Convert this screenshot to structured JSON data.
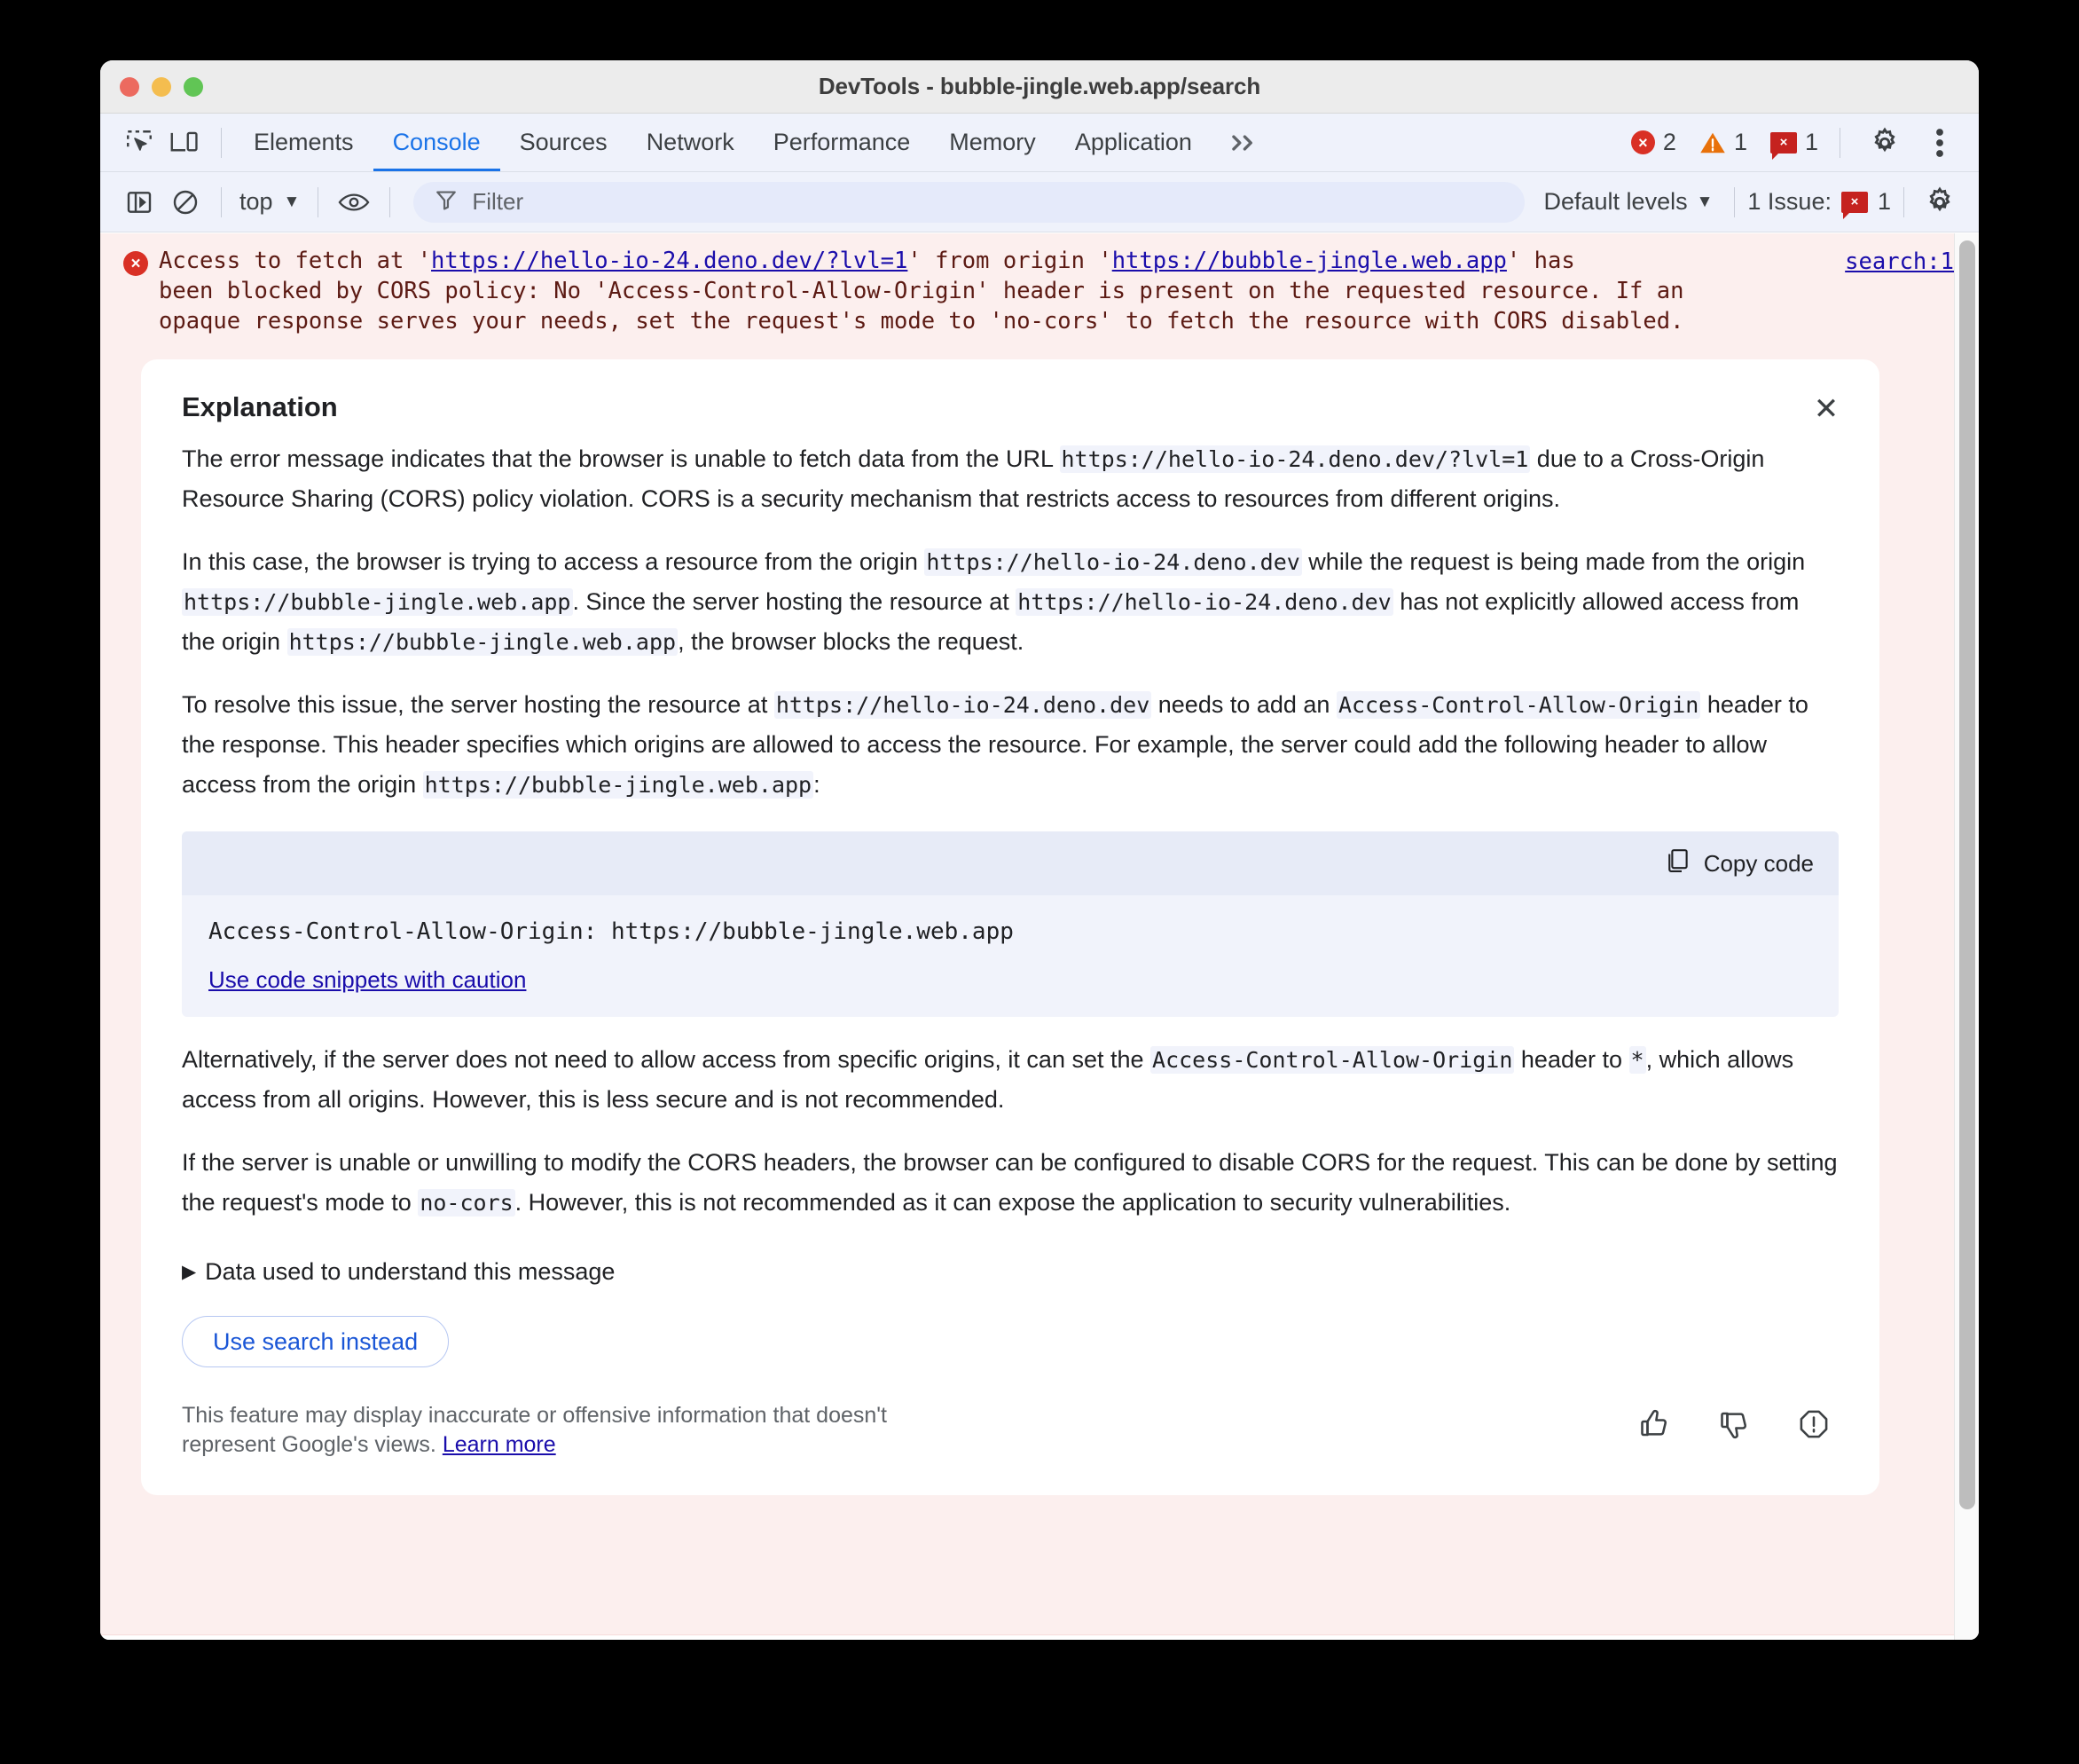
{
  "window": {
    "title": "DevTools - bubble-jingle.web.app/search",
    "traffic_lights": [
      "close",
      "minimize",
      "zoom"
    ]
  },
  "tabstrip": {
    "left_icons": [
      {
        "name": "inspect-element-icon"
      },
      {
        "name": "device-toolbar-icon"
      }
    ],
    "tabs": [
      {
        "label": "Elements",
        "active": false
      },
      {
        "label": "Console",
        "active": true
      },
      {
        "label": "Sources",
        "active": false
      },
      {
        "label": "Network",
        "active": false
      },
      {
        "label": "Performance",
        "active": false
      },
      {
        "label": "Memory",
        "active": false
      },
      {
        "label": "Application",
        "active": false
      }
    ],
    "more_tabs_label": "»",
    "counters": {
      "errors": "2",
      "warnings": "1",
      "issues": "1",
      "error_glyph": "×",
      "issue_glyph": "×"
    },
    "settings_label": "settings-gear",
    "menu_label": "more-options"
  },
  "consolebar": {
    "sidebar_toggle": "console-sidebar-icon",
    "clear_label": "clear-console-icon",
    "context": "top",
    "caret": "▼",
    "eye_label": "live-expressions-icon",
    "filter": {
      "icon": "filter-icon",
      "placeholder": "Filter",
      "value": ""
    },
    "levels_label": "Default levels",
    "levels_caret": "▼",
    "issues_label": "1 Issue:",
    "issues_count": "1",
    "settings_label": "console-settings-gear"
  },
  "error_message": {
    "icon": "error-circle-icon",
    "glyph": "×",
    "prefix": "Access to fetch at '",
    "url1": "https://hello-io-24.deno.dev/?lvl=1",
    "mid": "' from origin '",
    "url2": "https://bubble-jingle.web.app",
    "suffix": "' has",
    "line2": "been blocked by CORS policy: No 'Access-Control-Allow-Origin' header is present on the requested resource. If an",
    "line3": "opaque response serves your needs, set the request's mode to 'no-cors' to fetch the resource with CORS disabled.",
    "source_link": "search:1"
  },
  "explanation": {
    "title": "Explanation",
    "close_glyph": "✕",
    "paragraph1": {
      "a": "The error message indicates that the browser is unable to fetch data from the URL ",
      "code1": "https://hello-io-24.deno.dev/?lvl=1",
      "b": " due to a Cross-Origin Resource Sharing (CORS) policy violation. CORS is a security mechanism that restricts access to resources from different origins."
    },
    "paragraph2": {
      "a": "In this case, the browser is trying to access a resource from the origin ",
      "code1": "https://hello-io-24.deno.dev",
      "b": " while the request is being made from the origin ",
      "code2": "https://bubble-jingle.web.app",
      "c": ". Since the server hosting the resource at ",
      "code3": "https://hello-io-24.deno.dev",
      "d": " has not explicitly allowed access from the origin ",
      "code4": "https://bubble-jingle.web.app",
      "e": ", the browser blocks the request."
    },
    "paragraph3": {
      "a": "To resolve this issue, the server hosting the resource at ",
      "code1": "https://hello-io-24.deno.dev",
      "b": " needs to add an ",
      "code2": "Access-Control-Allow-Origin",
      "c": " header to the response. This header specifies which origins are allowed to access the resource. For example, the server could add the following header to allow access from the origin ",
      "code3": "https://bubble-jingle.web.app",
      "d": ":"
    },
    "code_block": {
      "copy_label": "Copy code",
      "copy_icon": "copy-icon",
      "snippet": "Access-Control-Allow-Origin: https://bubble-jingle.web.app",
      "caution_link": "Use code snippets with caution"
    },
    "paragraph4": {
      "a": "Alternatively, if the server does not need to allow access from specific origins, it can set the ",
      "code1": "Access-Control-Allow-Origin",
      "b": " header to ",
      "code2": "*",
      "c": ", which allows access from all origins. However, this is less secure and is not recommended."
    },
    "paragraph5": {
      "a": "If the server is unable or unwilling to modify the CORS headers, the browser can be configured to disable CORS for the request. This can be done by setting the request's mode to ",
      "code1": "no-cors",
      "b": ". However, this is not recommended as it can expose the application to security vulnerabilities."
    },
    "disclosure": {
      "triangle": "▶",
      "label": "Data used to understand this message"
    },
    "search_button": "Use search instead",
    "disclaimer": {
      "text": "This feature may display inaccurate or offensive information that doesn't represent Google's views. ",
      "link": "Learn more"
    },
    "feedback": {
      "thumb_up": "thumb-up-icon",
      "thumb_down": "thumb-down-icon",
      "report": "report-icon"
    }
  },
  "colors": {
    "accent": "#1a73e8",
    "error": "#d93025",
    "warning": "#e8710a",
    "link": "#1a0dab",
    "error_bg": "#fcefee",
    "toolbar_bg": "#eff2fb"
  }
}
